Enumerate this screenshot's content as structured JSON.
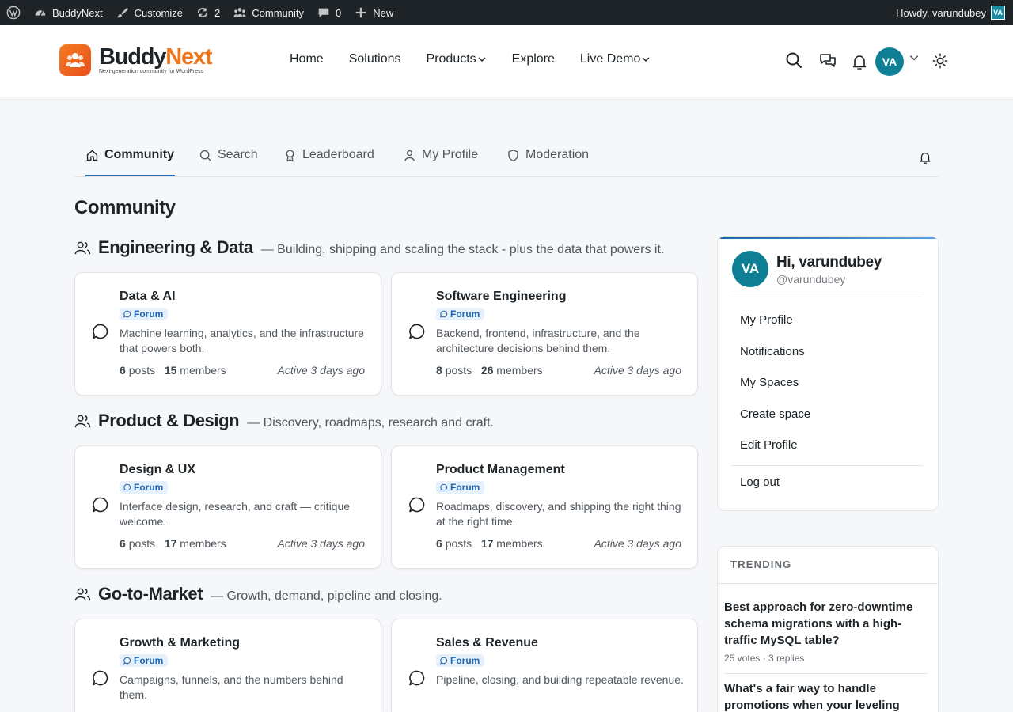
{
  "admin_bar": {
    "site_name": "BuddyNext",
    "customize": "Customize",
    "updates_count": "2",
    "community": "Community",
    "comments_count": "0",
    "new": "New",
    "howdy": "Howdy, varundubey",
    "avatar_initials": "VA"
  },
  "header": {
    "logo_part1": "Buddy",
    "logo_part2": "Next",
    "tagline": "Next-generation community for WordPress",
    "nav": [
      {
        "label": "Home"
      },
      {
        "label": "Solutions"
      },
      {
        "label": "Products"
      },
      {
        "label": "Explore"
      },
      {
        "label": "Live Demo"
      }
    ],
    "avatar_initials": "VA"
  },
  "tabs": [
    {
      "label": "Community",
      "icon": "home-icon",
      "active": true
    },
    {
      "label": "Search",
      "icon": "search-icon"
    },
    {
      "label": "Leaderboard",
      "icon": "award-icon"
    },
    {
      "label": "My Profile",
      "icon": "user-icon"
    },
    {
      "label": "Moderation",
      "icon": "shield-icon"
    }
  ],
  "page_title": "Community",
  "sections": [
    {
      "name": "Engineering & Data",
      "description": "— Building, shipping and scaling the stack - plus the data that powers it.",
      "cards": [
        {
          "title": "Data & AI",
          "badge": "Forum",
          "description": "Machine learning, analytics, and the infrastructure that powers both.",
          "posts": "6",
          "posts_label": "posts",
          "members": "15",
          "members_label": "members",
          "active": "Active 3 days ago"
        },
        {
          "title": "Software Engineering",
          "badge": "Forum",
          "description": "Backend, frontend, infrastructure, and the architecture decisions behind them.",
          "posts": "8",
          "posts_label": "posts",
          "members": "26",
          "members_label": "members",
          "active": "Active 3 days ago"
        }
      ]
    },
    {
      "name": "Product & Design",
      "description": "— Discovery, roadmaps, research and craft.",
      "cards": [
        {
          "title": "Design & UX",
          "badge": "Forum",
          "description": "Interface design, research, and craft — critique welcome.",
          "posts": "6",
          "posts_label": "posts",
          "members": "17",
          "members_label": "members",
          "active": "Active 3 days ago"
        },
        {
          "title": "Product Management",
          "badge": "Forum",
          "description": "Roadmaps, discovery, and shipping the right thing at the right time.",
          "posts": "6",
          "posts_label": "posts",
          "members": "17",
          "members_label": "members",
          "active": "Active 3 days ago"
        }
      ]
    },
    {
      "name": "Go-to-Market",
      "description": "— Growth, demand, pipeline and closing.",
      "cards": [
        {
          "title": "Growth & Marketing",
          "badge": "Forum",
          "description": "Campaigns, funnels, and the numbers behind them."
        },
        {
          "title": "Sales & Revenue",
          "badge": "Forum",
          "description": "Pipeline, closing, and building repeatable revenue."
        }
      ]
    }
  ],
  "user_card": {
    "avatar_initials": "VA",
    "greeting": "Hi, varundubey",
    "handle": "@varundubey",
    "links": [
      "My Profile",
      "Notifications",
      "My Spaces",
      "Create space",
      "Edit Profile"
    ],
    "logout": "Log out"
  },
  "trending": {
    "label": "TRENDING",
    "items": [
      {
        "title": "Best approach for zero-downtime schema migrations with a high-traffic MySQL table?",
        "meta": "25 votes · 3 replies"
      },
      {
        "title": "What's a fair way to handle promotions when your leveling"
      }
    ]
  },
  "colors": {
    "admin_bar": "#1d2327",
    "brand_orange": "#f0761c",
    "accent_blue": "#1d6fb8",
    "avatar_teal": "#0e7f95",
    "badge_bg": "#e7f1fb"
  }
}
